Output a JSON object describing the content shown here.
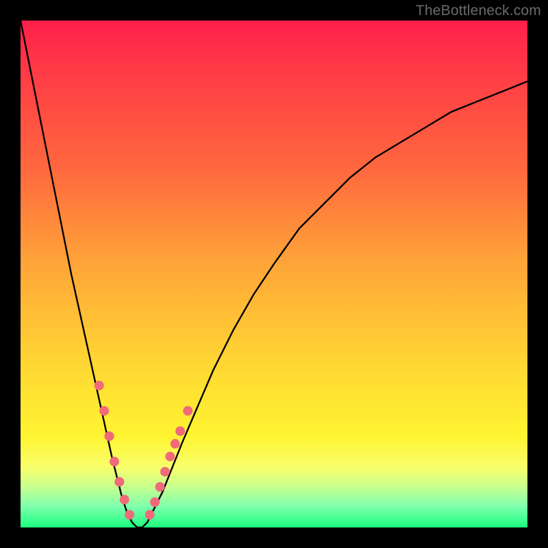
{
  "watermark": "TheBottleneck.com",
  "chart_data": {
    "type": "line",
    "title": "",
    "xlabel": "",
    "ylabel": "",
    "xlim": [
      0,
      100
    ],
    "ylim": [
      0,
      100
    ],
    "background_gradient": {
      "stops": [
        {
          "pos": 0,
          "color": "#ff1f4a"
        },
        {
          "pos": 10,
          "color": "#ff3b46"
        },
        {
          "pos": 30,
          "color": "#ff6a3e"
        },
        {
          "pos": 48,
          "color": "#ffa538"
        },
        {
          "pos": 68,
          "color": "#ffd733"
        },
        {
          "pos": 82,
          "color": "#fff431"
        },
        {
          "pos": 88,
          "color": "#f9ff6a"
        },
        {
          "pos": 92,
          "color": "#c8ff8f"
        },
        {
          "pos": 96,
          "color": "#7bffad"
        },
        {
          "pos": 100,
          "color": "#1bff7e"
        }
      ]
    },
    "x": [
      0,
      2,
      4,
      6,
      8,
      10,
      12,
      14,
      16,
      18,
      19,
      20,
      21,
      22,
      23,
      24,
      25,
      26,
      28,
      30,
      32,
      35,
      38,
      42,
      46,
      50,
      55,
      60,
      65,
      70,
      75,
      80,
      85,
      90,
      95,
      100
    ],
    "values": [
      100,
      90,
      80,
      70,
      60,
      50,
      41,
      32,
      23,
      14,
      10,
      6,
      3,
      1,
      0,
      0,
      1,
      3,
      7,
      12,
      17,
      24,
      31,
      39,
      46,
      52,
      59,
      64,
      69,
      73,
      76,
      79,
      82,
      84,
      86,
      88
    ],
    "highlight_points": {
      "left_branch_x": [
        15.5,
        16.5,
        17.5,
        18.5,
        19.5,
        20.5,
        21.5
      ],
      "left_branch_y": [
        28,
        23,
        18,
        13,
        9,
        5.5,
        2.5
      ],
      "right_branch_x": [
        25.5,
        26.5,
        27.5,
        28.5,
        29.5,
        30.5,
        31.5,
        33.0
      ],
      "right_branch_y": [
        2.5,
        5,
        8,
        11,
        14,
        16.5,
        19,
        23
      ],
      "color": "#f06a7a",
      "radius_px": 7
    }
  }
}
